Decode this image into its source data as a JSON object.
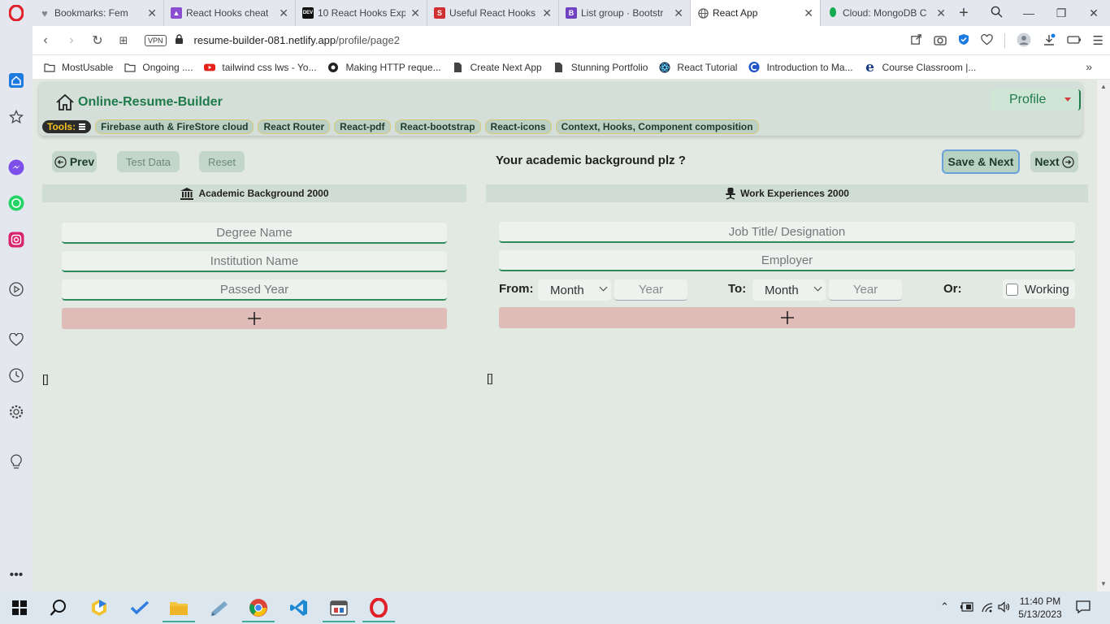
{
  "browser": {
    "tabs": [
      {
        "title": "Bookmarks: Fem",
        "fav_color": "#888888",
        "active": false
      },
      {
        "title": "React Hooks cheat",
        "fav_color": "#8a4fd0",
        "active": false
      },
      {
        "title": "10 React Hooks Exp",
        "fav_color": "#111111",
        "fav_text": "DEV",
        "active": false
      },
      {
        "title": "Useful React Hooks",
        "fav_color": "#d03030",
        "fav_text": "S",
        "active": false
      },
      {
        "title": "List group · Bootstr",
        "fav_color": "#6f42c1",
        "fav_text": "B",
        "active": false
      },
      {
        "title": "React App",
        "fav_color": "#666666",
        "active": true
      },
      {
        "title": "Cloud: MongoDB C",
        "fav_color": "#13aa52",
        "active": false
      }
    ],
    "url_host": "resume-builder-081.netlify.app",
    "url_path": "/profile/page2",
    "vpn_label": "VPN",
    "bookmarks": [
      {
        "label": "MostUsable",
        "icon": "folder-icon"
      },
      {
        "label": "Ongoing ....",
        "icon": "folder-icon"
      },
      {
        "label": "tailwind css lws - Yo...",
        "icon": "youtube-icon"
      },
      {
        "label": "Making HTTP reque...",
        "icon": "site-icon"
      },
      {
        "label": "Create Next App",
        "icon": "page-icon"
      },
      {
        "label": "Stunning Portfolio",
        "icon": "page-icon"
      },
      {
        "label": "React Tutorial",
        "icon": "react-icon"
      },
      {
        "label": "Introduction to Ma...",
        "icon": "c-icon"
      },
      {
        "label": "Course Classroom |...",
        "icon": "e-icon"
      }
    ]
  },
  "app": {
    "brand": "Online-Resume-Builder",
    "profile_label": "Profile",
    "tools_label": "Tools:",
    "tools": [
      "Firebase auth & FireStore cloud",
      "React Router",
      "React-pdf",
      "React-bootstrap",
      "React-icons",
      "Context, Hooks, Component composition"
    ],
    "prev_label": "Prev",
    "test_data_label": "Test Data",
    "reset_label": "Reset",
    "question": "Your academic background plz ?",
    "save_next_label": "Save & Next",
    "next_label": "Next",
    "academic": {
      "heading": "Academic Background 2000",
      "degree_placeholder": "Degree Name",
      "institution_placeholder": "Institution Name",
      "passed_year_placeholder": "Passed Year",
      "add_symbol": "+",
      "list_output": "[]"
    },
    "work": {
      "heading": "Work Experiences 2000",
      "job_title_placeholder": "Job Title/ Designation",
      "employer_placeholder": "Employer",
      "from_label": "From:",
      "to_label": "To:",
      "or_label": "Or:",
      "month_label": "Month",
      "year_placeholder": "Year",
      "working_label": "Working",
      "add_symbol": "+",
      "list_output": "[]"
    }
  },
  "taskbar": {
    "time": "11:40 PM",
    "date": "5/13/2023"
  }
}
